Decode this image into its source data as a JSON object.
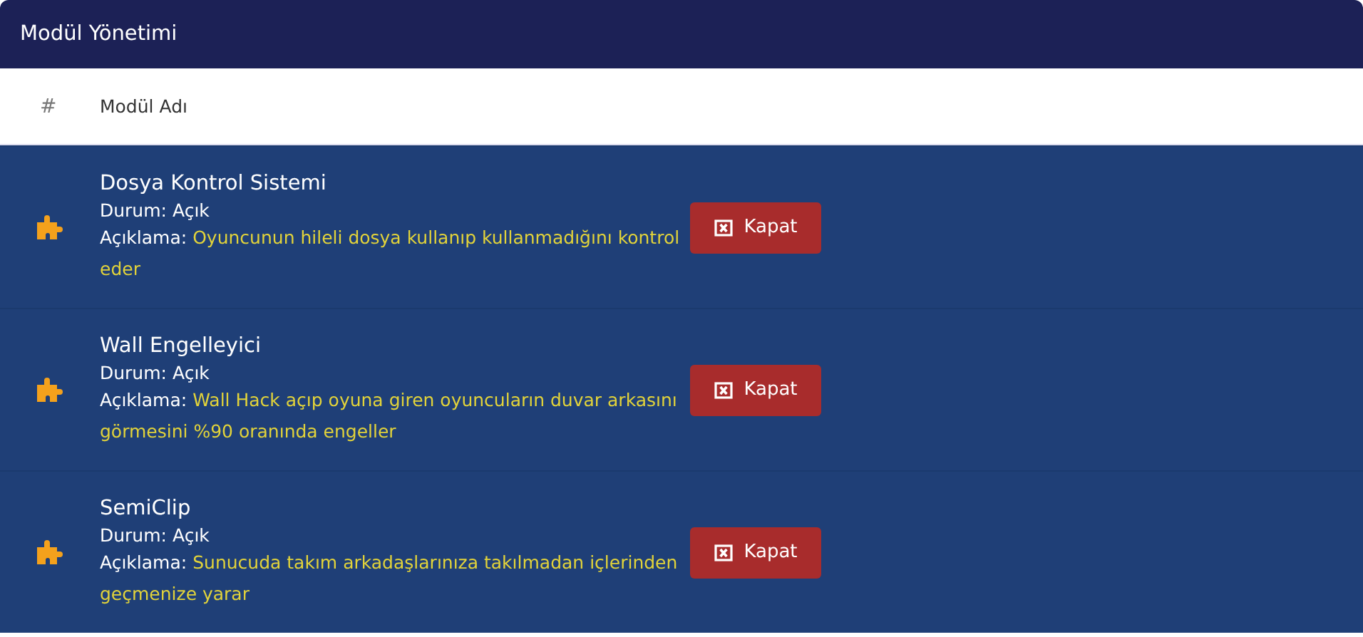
{
  "card": {
    "title": "Modül Yönetimi"
  },
  "table": {
    "columns": [
      "#",
      "Modül Adı"
    ],
    "rows": [
      {
        "name": "Dosya Kontrol Sistemi",
        "status_label": "Durum:",
        "status": "Açık",
        "description_label": "Açıklama:",
        "description": "Oyuncunun hileli dosya kullanıp kullanmadığını kontrol eder",
        "button": "Kapat"
      },
      {
        "name": "Wall Engelleyici",
        "status_label": "Durum:",
        "status": "Açık",
        "description_label": "Açıklama:",
        "description": "Wall Hack açıp oyuna giren oyuncuların duvar arkasını görmesini %90 oranında engeller",
        "button": "Kapat"
      },
      {
        "name": "SemiClip",
        "status_label": "Durum:",
        "status": "Açık",
        "description_label": "Açıklama:",
        "description": "Sunucuda takım arkadaşlarınıza takılmadan içlerinden geçmenize yarar",
        "button": "Kapat"
      }
    ]
  }
}
